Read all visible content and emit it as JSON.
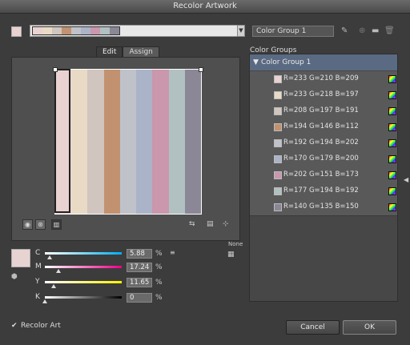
{
  "window": {
    "title": "Recolor Artwork"
  },
  "toolbar": {
    "harmony_chips": [
      "#e9d2d1",
      "#e9dac5",
      "#d0c5bf",
      "#c29270",
      "#c0c2ca",
      "#aab3c8",
      "#ca97ad",
      "#b1c0c0",
      "#8c8796"
    ],
    "group_name": "Color Group 1",
    "icons": {
      "eyedropper": "eyedropper-icon",
      "new_group": "new-group-icon",
      "folder": "folder-icon",
      "trash": "trash-icon"
    }
  },
  "tabs": [
    {
      "label": "Edit",
      "active": true
    },
    {
      "label": "Assign",
      "active": false
    }
  ],
  "bars": [
    "#e9d2d1",
    "#e9dac5",
    "#d0c5bf",
    "#c29270",
    "#c0c2ca",
    "#aab3c8",
    "#ca97ad",
    "#b1c0c0",
    "#8c8796"
  ],
  "controls": {
    "none_label": "None"
  },
  "sliders": {
    "mode": "CMYK",
    "swatch_color": "#e8d3d3",
    "rows": [
      {
        "label": "C",
        "value": "5.88",
        "unit": "%",
        "level": 0.0588,
        "gradient": "linear-gradient(90deg,#ffffff,#00aeef)"
      },
      {
        "label": "M",
        "value": "17.24",
        "unit": "%",
        "level": 0.1724,
        "gradient": "linear-gradient(90deg,#ffffff,#ec008c)"
      },
      {
        "label": "Y",
        "value": "11.65",
        "unit": "%",
        "level": 0.1165,
        "gradient": "linear-gradient(90deg,#ffffff,#fff200)"
      },
      {
        "label": "K",
        "value": "0",
        "unit": "%",
        "level": 0,
        "gradient": "linear-gradient(90deg,#ffffff,#000000)"
      }
    ]
  },
  "color_groups": {
    "label": "Color Groups",
    "group": {
      "name": "Color Group 1"
    },
    "items": [
      {
        "color": "#e9d2d1",
        "label": "R=233 G=210 B=209"
      },
      {
        "color": "#e9dac5",
        "label": "R=233 G=218 B=197"
      },
      {
        "color": "#d0c5bf",
        "label": "R=208 G=197 B=191"
      },
      {
        "color": "#c29270",
        "label": "R=194 G=146 B=112"
      },
      {
        "color": "#c0c2ca",
        "label": "R=192 G=194 B=202"
      },
      {
        "color": "#aab3c8",
        "label": "R=170 G=179 B=200"
      },
      {
        "color": "#ca97ad",
        "label": "R=202 G=151 B=173"
      },
      {
        "color": "#b1c0c0",
        "label": "R=177 G=194 B=192"
      },
      {
        "color": "#8c8796",
        "label": "R=140 G=135 B=150"
      }
    ]
  },
  "footer": {
    "recolor_art_label": "Recolor Art",
    "recolor_art_checked": true,
    "cancel_label": "Cancel",
    "ok_label": "OK"
  }
}
